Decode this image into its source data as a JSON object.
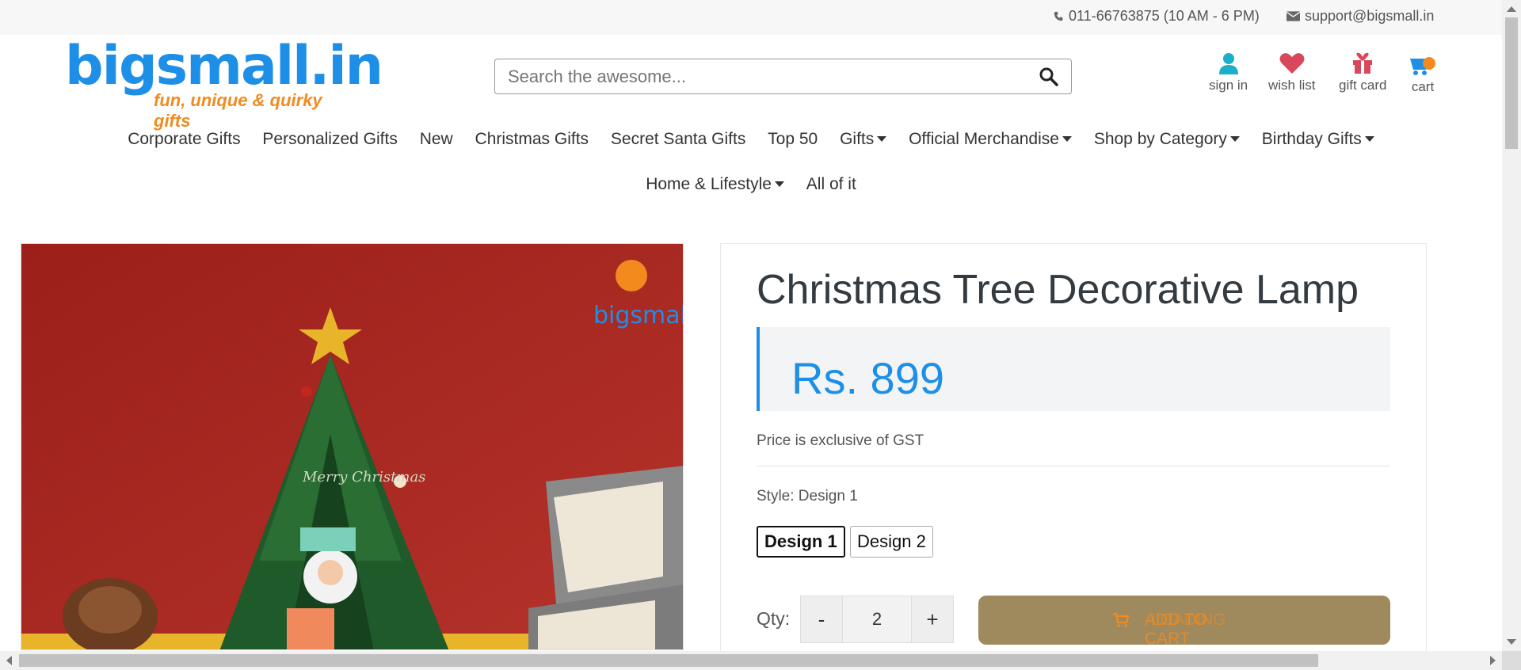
{
  "topbar": {
    "phone": "011-66763875 (10 AM - 6 PM)",
    "email": "support@bigsmall.in"
  },
  "logo": {
    "brand": "bigsmall.in",
    "tagline": "fun, unique & quirky gifts"
  },
  "search": {
    "placeholder": "Search the awesome..."
  },
  "header_icons": {
    "signin": "sign in",
    "wishlist": "wish list",
    "giftcard": "gift card",
    "cart": "cart"
  },
  "nav": {
    "row1": [
      "Corporate Gifts",
      "Personalized Gifts",
      "New",
      "Christmas Gifts",
      "Secret Santa Gifts",
      "Top 50",
      "Gifts",
      "Official Merchandise",
      "Shop by Category",
      "Birthday Gifts"
    ],
    "row2": [
      "Home & Lifestyle",
      "All of it"
    ]
  },
  "product": {
    "title": "Christmas Tree Decorative Lamp",
    "price": "Rs. 899",
    "gst_note": "Price is exclusive of GST",
    "style_label": "Style: Design 1",
    "designs": [
      "Design 1",
      "Design 2"
    ],
    "qty_label": "Qty:",
    "qty_minus": "-",
    "qty_value": "2",
    "qty_plus": "+",
    "cart_button": "ADD TO CART",
    "cart_overlay": "LOADING",
    "image_watermark": "bigsmall.in",
    "image_text": "Merry Christmas"
  },
  "colors": {
    "brand_blue": "#1e8fe6",
    "brand_orange": "#f28a1e",
    "cart_button": "#9f8a5e"
  }
}
